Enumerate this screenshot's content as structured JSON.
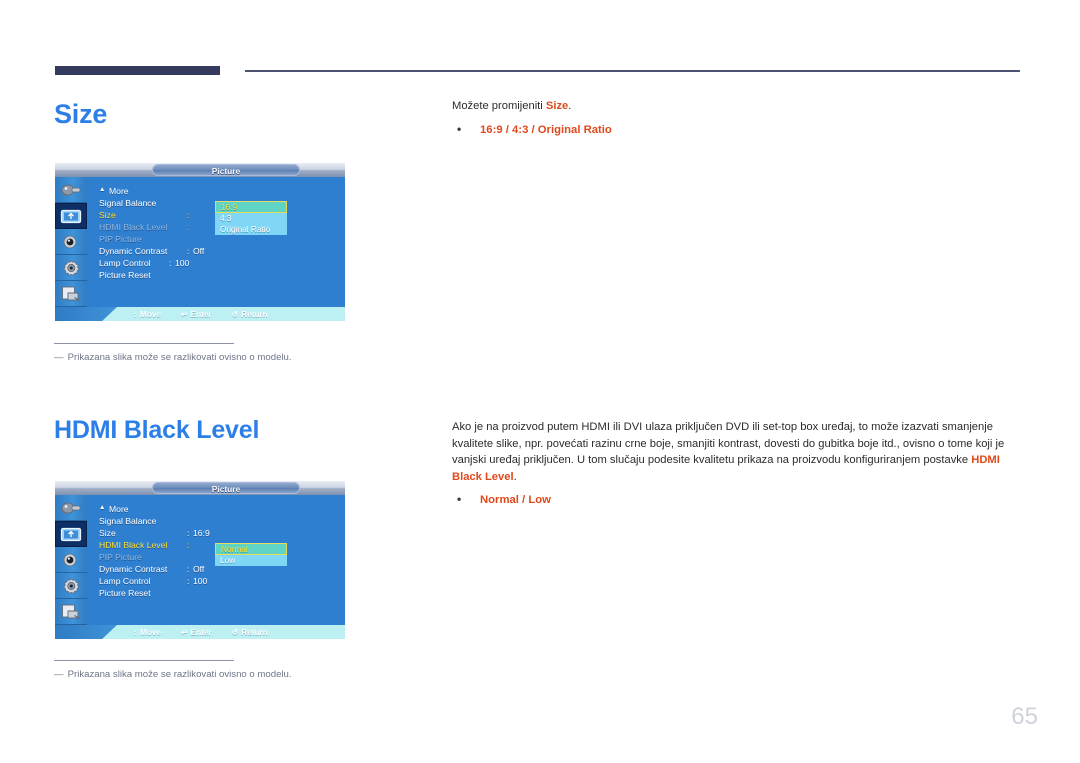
{
  "page": {
    "number": "65"
  },
  "sections": [
    {
      "id": "size",
      "title": "Size",
      "intro_before": "Možete promijeniti ",
      "intro_keyword": "Size",
      "intro_after": ".",
      "bullets": [
        "16:9 / 4:3 / Original Ratio"
      ],
      "footnote_dash": "―",
      "footnote": "Prikazana slika može se razlikovati ovisno o modelu."
    },
    {
      "id": "hdmi_black_level",
      "title": "HDMI Black Level",
      "paragraph_before": "Ako je na proizvod putem HDMI ili DVI ulaza priključen DVD ili set-top box uređaj, to može izazvati smanjenje kvalitete slike, npr. povećati razinu crne boje, smanjiti kontrast, dovesti do gubitka boje itd., ovisno o tome koji je vanjski uređaj priključen. U tom slučaju podesite kvalitetu prikaza na proizvodu konfiguriranjem postavke ",
      "paragraph_keyword": "HDMI Black Level",
      "paragraph_after": ".",
      "bullets": [
        "Normal / Low"
      ],
      "footnote_dash": "―",
      "footnote": "Prikazana slika može se razlikovati ovisno o modelu."
    }
  ],
  "osd_size": {
    "header_title": "Picture",
    "rail_icons": [
      "input-source-icon",
      "picture-display-icon",
      "sound-speaker-icon",
      "setup-gear-icon",
      "multi-control-icon"
    ],
    "selected_rail_index": 1,
    "rows": [
      {
        "label": "More",
        "colon": "",
        "value": "",
        "state": "more"
      },
      {
        "label": "Signal Balance",
        "colon": "",
        "value": "",
        "state": "normal"
      },
      {
        "label": "Size",
        "colon": ":",
        "value": "",
        "state": "highlight"
      },
      {
        "label": "HDMI Black Level",
        "colon": ":",
        "value": "",
        "state": "dim"
      },
      {
        "label": "PIP Picture",
        "colon": "",
        "value": "",
        "state": "dim"
      },
      {
        "label": "Dynamic Contrast",
        "colon": ":",
        "value": "Off",
        "state": "normal"
      },
      {
        "label": "Lamp Control",
        "colon": ":",
        "value": "100",
        "state": "normal"
      },
      {
        "label": "Picture Reset",
        "colon": "",
        "value": "",
        "state": "normal"
      }
    ],
    "dropdown": {
      "options": [
        "16:9",
        "4:3",
        "Original Ratio"
      ],
      "selected": "16:9"
    },
    "footer": {
      "move_glyph": "↕",
      "move_label": "Move",
      "enter_glyph": "↵",
      "enter_label": "Enter",
      "return_glyph": "↺",
      "return_label": "Return"
    }
  },
  "osd_hdmi": {
    "header_title": "Picture",
    "rail_icons": [
      "input-source-icon",
      "picture-display-icon",
      "sound-speaker-icon",
      "setup-gear-icon",
      "multi-control-icon"
    ],
    "selected_rail_index": 1,
    "rows": [
      {
        "label": "More",
        "colon": "",
        "value": "",
        "state": "more"
      },
      {
        "label": "Signal Balance",
        "colon": "",
        "value": "",
        "state": "normal"
      },
      {
        "label": "Size",
        "colon": ":",
        "value": "16:9",
        "state": "normal"
      },
      {
        "label": "HDMI Black Level",
        "colon": ":",
        "value": "",
        "state": "highlight"
      },
      {
        "label": "PIP Picture",
        "colon": "",
        "value": "",
        "state": "dim"
      },
      {
        "label": "Dynamic Contrast",
        "colon": ":",
        "value": "Off",
        "state": "normal"
      },
      {
        "label": "Lamp Control",
        "colon": ":",
        "value": "100",
        "state": "normal"
      },
      {
        "label": "Picture Reset",
        "colon": "",
        "value": "",
        "state": "normal"
      }
    ],
    "dropdown": {
      "options": [
        "Normal",
        "Low"
      ],
      "selected": "Normal"
    },
    "footer": {
      "move_glyph": "↕",
      "move_label": "Move",
      "enter_glyph": "↵",
      "enter_label": "Enter",
      "return_glyph": "↺",
      "return_label": "Return"
    }
  },
  "colors": {
    "heading_blue": "#2d7fe8",
    "keyword_orange": "#e0491c",
    "osd_blue": "#2f7fd0",
    "osd_highlight_yellow": "#ffe02e",
    "osd_select_teal": "#5fd3c4",
    "osd_option_cyan": "#7fd6f5",
    "rule_navy": "#343b5e",
    "page_number_gray": "#cfd2da"
  }
}
